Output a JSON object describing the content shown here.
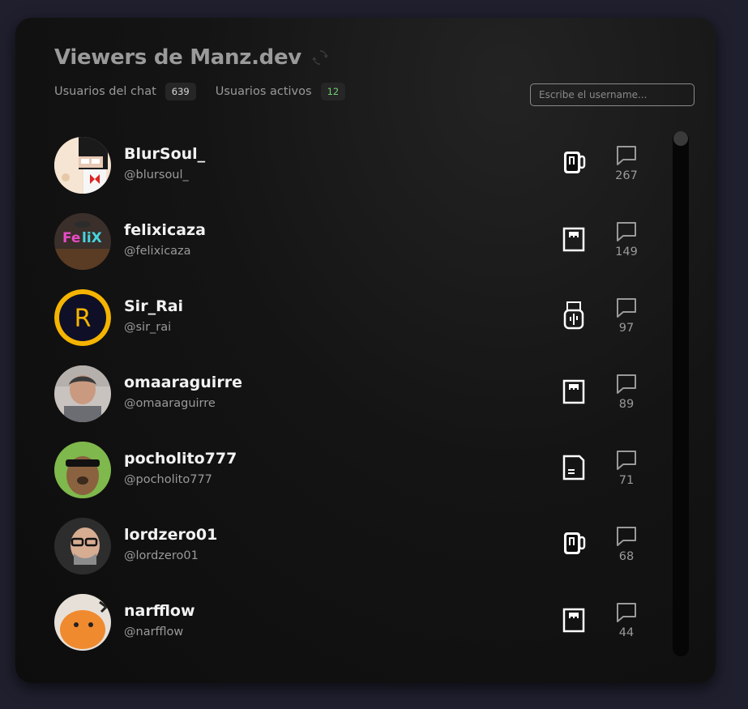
{
  "header": {
    "title": "Viewers de Manz.dev",
    "refresh_icon": "refresh-icon"
  },
  "stats": {
    "chat_users_label": "Usuarios del chat",
    "chat_users_count": "639",
    "active_users_label": "Usuarios activos",
    "active_users_count": "12"
  },
  "search": {
    "placeholder": "Escribe el username...",
    "value": ""
  },
  "viewers": [
    {
      "name": "BlurSoul_",
      "handle": "@blursoul_",
      "messages": "267",
      "device": "mug-icon"
    },
    {
      "name": "felixicaza",
      "handle": "@felixicaza",
      "messages": "149",
      "device": "sd-card-icon"
    },
    {
      "name": "Sir_Rai",
      "handle": "@sir_rai",
      "messages": "97",
      "device": "usb-icon"
    },
    {
      "name": "omaaraguirre",
      "handle": "@omaaraguirre",
      "messages": "89",
      "device": "sd-card-icon"
    },
    {
      "name": "pocholito777",
      "handle": "@pocholito777",
      "messages": "71",
      "device": "floppy-icon"
    },
    {
      "name": "lordzero01",
      "handle": "@lordzero01",
      "messages": "68",
      "device": "mug-icon"
    },
    {
      "name": "narfflow",
      "handle": "@narfflow",
      "messages": "44",
      "device": "sd-card-icon"
    }
  ],
  "colors": {
    "background": "#1f1f2e",
    "panel": "#111111",
    "active_badge": "#6fcf6f",
    "sir_rai_ring": "#f5b400"
  }
}
